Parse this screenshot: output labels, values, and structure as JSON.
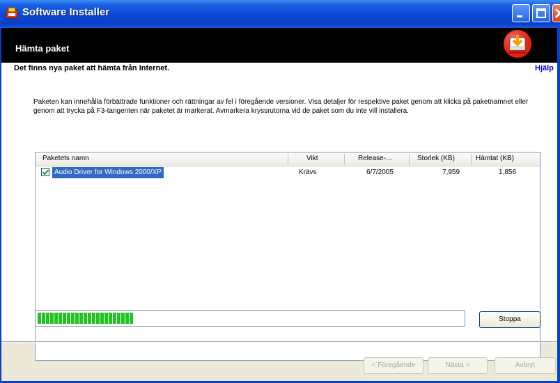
{
  "window": {
    "title": "Software Installer",
    "title_icon": "installer-app-icon",
    "controls": {
      "minimize_icon": "minimize-icon",
      "maximize_icon": "maximize-icon",
      "close_icon": "close-icon"
    }
  },
  "header": {
    "title": "Hämta paket",
    "icon": "download-package-icon"
  },
  "page": {
    "subtitle": "Det finns nya paket att hämta från Internet.",
    "help_link": "Hjälp",
    "description": "Paketen kan innehålla förbättrade funktioner och rättningar av fel i föregående versioner. Visa detaljer för respektive paket genom att klicka på paketnamnet eller genom att trycka på F3-tangenten när paketet är markerat. Avmarkera kryssrutorna vid de paket som du inte vill installera."
  },
  "package_list": {
    "columns": [
      "Paketets namn",
      "Vikt",
      "Release-...",
      "Storlek (KB)",
      "Hämtat (KB)"
    ],
    "rows": [
      {
        "checked": true,
        "name": "Audio Driver for Windows 2000/XP",
        "weight": "Krävs",
        "release": "6/7/2005",
        "size_kb": "7,959",
        "downloaded_kb": "1,856"
      }
    ]
  },
  "progress": {
    "value": 0.26,
    "color": "#21c321",
    "segments_shown": 23
  },
  "buttons": {
    "stop": "Stoppa",
    "previous": "< Föregående",
    "next": "Nästa >",
    "cancel": "Avbryt"
  },
  "colors": {
    "title_bar": "#0a4ad6",
    "header_bar": "#000000",
    "selection": "#316ac5",
    "help_link": "#0000cc"
  }
}
